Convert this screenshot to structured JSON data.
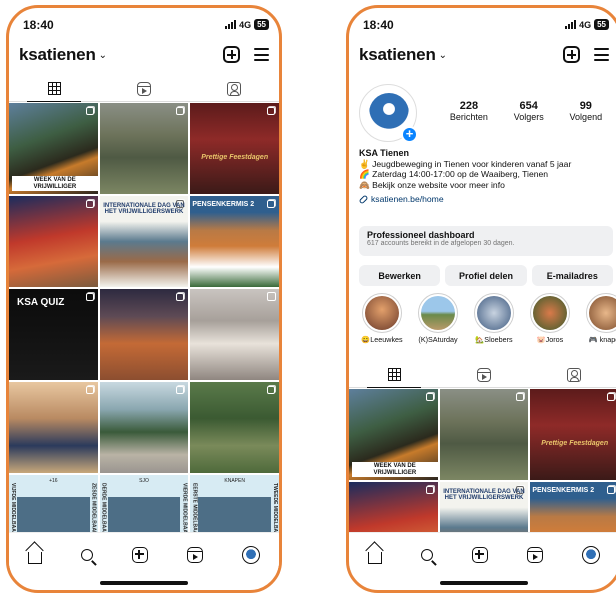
{
  "left": {
    "status": {
      "time": "18:40",
      "network": "4G",
      "battery": "55"
    },
    "username": "ksatienen",
    "posts": [
      {
        "caption": "WEEK VAN DE VRIJWILLIGER",
        "badge": "multi"
      },
      {
        "caption": "",
        "badge": "multi"
      },
      {
        "caption": "Prettige Feestdagen",
        "badge": "multi"
      },
      {
        "caption": "",
        "badge": "multi"
      },
      {
        "caption": "INTERNATIONALE DAG VAN HET VRIJWILLIGERSWERK",
        "badge": "multi"
      },
      {
        "caption": "PENSENKERMIS 2",
        "badge": "multi"
      },
      {
        "caption": "KSA QUIZ",
        "badge": "multi"
      },
      {
        "caption": "",
        "badge": "multi"
      },
      {
        "caption": "",
        "badge": "reel"
      },
      {
        "caption": "",
        "badge": "multi"
      },
      {
        "caption": "",
        "badge": "multi"
      },
      {
        "caption": "",
        "badge": "multi"
      },
      {
        "caption": "VIJFDE MIDDELBAAR",
        "header": "+16",
        "badge": "none"
      },
      {
        "caption": "DERDE MIDDELBAAR",
        "header": "SJO",
        "badge": "none"
      },
      {
        "caption": "EERSTE MIDDELBAAR",
        "header": "KNAPEN",
        "badge": "none"
      }
    ],
    "clip_side": [
      "ZESDE MIDDELBAAR",
      "VIERDE MIDDELBAAR",
      "TWEEDE MIDDELBAAR"
    ]
  },
  "right": {
    "status": {
      "time": "18:40",
      "network": "4G",
      "battery": "55"
    },
    "username": "ksatienen",
    "stats": [
      {
        "num": "228",
        "label": "Berichten"
      },
      {
        "num": "654",
        "label": "Volgers"
      },
      {
        "num": "99",
        "label": "Volgend"
      }
    ],
    "bio": {
      "name": "KSA Tienen",
      "line1": "✌️ Jeugdbeweging in Tienen voor kinderen vanaf 5 jaar",
      "line2": "🌈 Zaterdag 14:00-17:00 op de Waaiberg, Tienen",
      "line3": "🙈 Bekijk onze website voor meer info",
      "link": "ksatienen.be/home"
    },
    "dashboard": {
      "title": "Professioneel dashboard",
      "subtitle": "617 accounts bereikt in de afgelopen 30 dagen."
    },
    "buttons": [
      "Bewerken",
      "Profiel delen",
      "E-mailadres"
    ],
    "highlights": [
      {
        "label": "😄Leeuwkes",
        "color": "#c86a3a"
      },
      {
        "label": "(K)SAturday",
        "color": "#7ab3d9"
      },
      {
        "label": "🏡Sloebers",
        "color": "#5a7aa0"
      },
      {
        "label": "🐷Joros",
        "color": "#c9583a"
      },
      {
        "label": "🎮 knapen",
        "color": "#8a5a3a"
      }
    ],
    "posts": [
      {
        "caption": "WEEK VAN DE VRIJWILLIGER",
        "badge": "multi"
      },
      {
        "caption": "",
        "badge": "multi"
      },
      {
        "caption": "Prettige Feestdagen",
        "badge": "multi"
      },
      {
        "caption": "",
        "badge": "multi"
      },
      {
        "caption": "INTERNATIONALE DAG VAN HET VRIJWILLIGERSWERK",
        "badge": "multi"
      },
      {
        "caption": "PENSENKERMIS 2",
        "badge": "multi"
      }
    ]
  },
  "colors": {
    "frame": "#e8843a",
    "accent": "#0a84ff",
    "link": "#00376b"
  }
}
